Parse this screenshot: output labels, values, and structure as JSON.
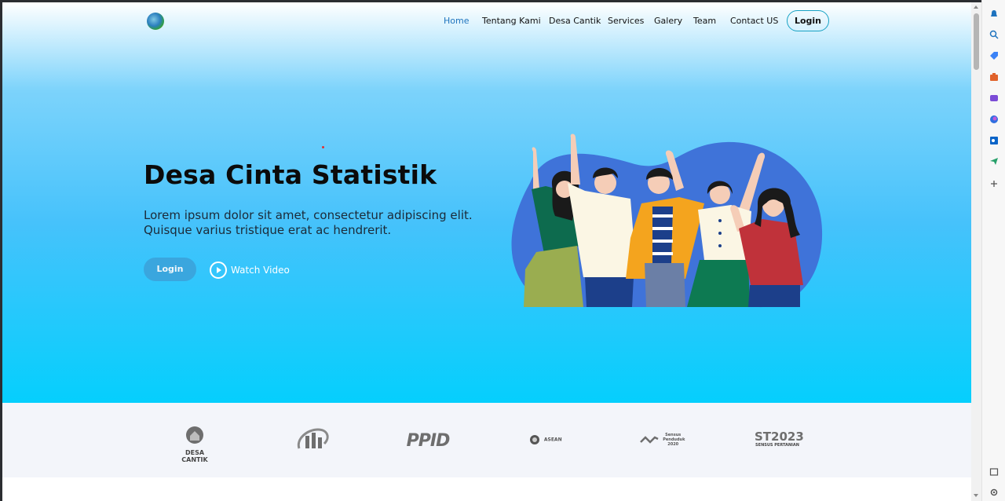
{
  "nav": {
    "items": [
      "Home",
      "Tentang Kami",
      "Desa Cantik",
      "Services",
      "Galery",
      "Team",
      "Contact US"
    ],
    "active": "Home",
    "login_label": "Login"
  },
  "hero": {
    "title": "Desa Cinta Statistik",
    "subtitle": "Lorem ipsum dolor sit amet, consectetur adipiscing elit. Quisque varius tristique erat ac hendrerit.",
    "login_label": "Login",
    "watch_label": "Watch Video",
    "illustration": "group-of-people-waving-illustration"
  },
  "partners": [
    {
      "name": "desa-cantik-logo",
      "text": "DESA CANTIK"
    },
    {
      "name": "bps-logo",
      "text": ""
    },
    {
      "name": "ppid-logo",
      "text": "PPID"
    },
    {
      "name": "asean-logo",
      "text": "ASEAN"
    },
    {
      "name": "sensus-penduduk-logo",
      "text": "Sensus Penduduk 2020"
    },
    {
      "name": "st2023-logo",
      "text": "ST2023"
    }
  ],
  "partner_texts": {
    "desa_cantik": "DESA CANTIK",
    "ppid": "PPID",
    "asean": "ASEAN",
    "sp": "Sensus Penduduk 2020",
    "st": "ST2023",
    "st_sub": "SENSUS PERTANIAN"
  },
  "colors": {
    "accent": "#1e73be",
    "button": "#3aa6de",
    "hero_bottom": "#05cffd",
    "partners_bg": "#f3f5fa"
  },
  "browser_sidebar": {
    "icons": [
      "bell-icon",
      "search-icon",
      "tag-icon",
      "briefcase-icon",
      "games-icon",
      "copilot-icon",
      "outlook-icon",
      "send-icon",
      "plus-icon",
      "panel-icon",
      "settings-icon"
    ]
  }
}
